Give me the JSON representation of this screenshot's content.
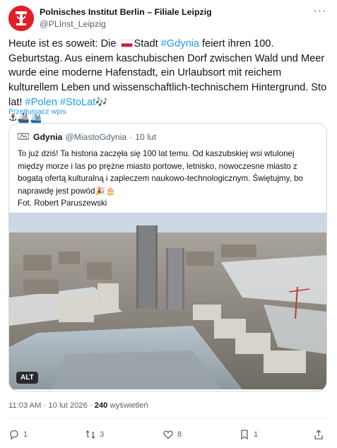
{
  "author": {
    "name": "Polnisches Institut Berlin – Filiale Leipzig",
    "handle": "@PLInst_Leipzig",
    "avatar_icon": "institute-logo-icon",
    "avatar_color": "#e0202b"
  },
  "tweet": {
    "part1": "Heute ist es soweit: Die ",
    "part2": "Stadt ",
    "hashtag_gdynia": "#Gdynia",
    "part3": " feiert ihren 100. Geburtstag. Aus einem kaschubischen Dorf zwischen Wald und Meer wurde eine moderne Hafenstadt, ein Urlaubsort mit reichem kulturellem Leben und wissenschaftlich-technischem Hintergrund. Sto lat! ",
    "hashtag_polen": "#Polen",
    "hashtag_stolat": "#StoLat",
    "emoji_music": "🎶",
    "emoji_line": "⚓🚢🛳️",
    "translate_label": "Przetłumacz wpis"
  },
  "quote": {
    "name": "Gdynia",
    "handle": "@MiastoGdynia",
    "separator": "·",
    "date": "10 lut",
    "text": "To już dziś! Ta historia zaczęła się 100 lat temu. Od kaszubskiej wsi wtulonej między morze i las po prężne miasto portowe, letnisko, nowoczesne miasto z bogatą ofertą kulturalną i zapleczem naukowo-technologicznym. Świętujmy, bo naprawdę jest powód",
    "emoji": "🎉🎂",
    "photo_credit": "Fot. Robert Paruszewski",
    "alt_label": "ALT"
  },
  "meta": {
    "time": "11:03 AM",
    "separator": "·",
    "date": "10 lut 2026",
    "views_count": "240",
    "views_label": "wyświetleń"
  },
  "actions": {
    "replies": "1",
    "reposts": "3",
    "likes": "8",
    "bookmarks": "1"
  },
  "colors": {
    "accent": "#1d9bf0",
    "text": "#0f1419",
    "secondary": "#536471",
    "border": "#cfd9de"
  }
}
